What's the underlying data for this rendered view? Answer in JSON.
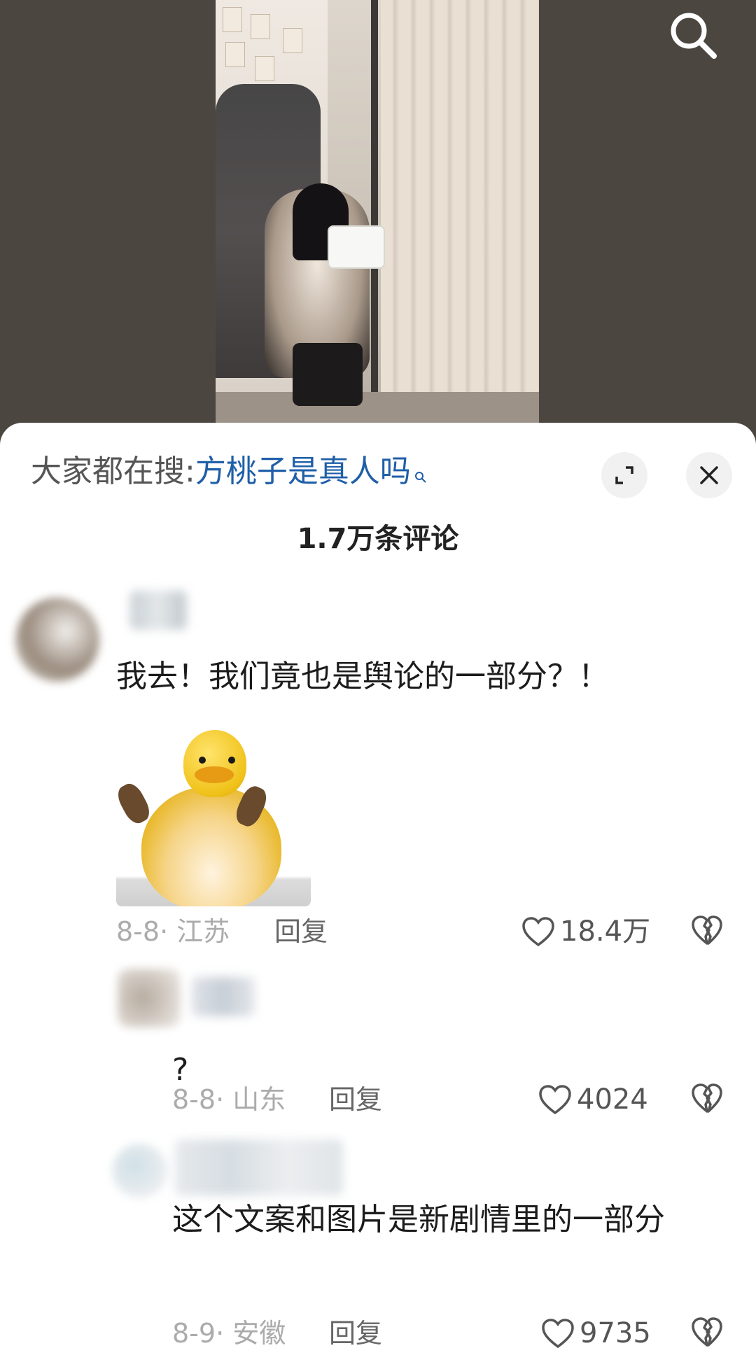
{
  "search_hint": {
    "prefix": "大家都在搜:",
    "keyword": "方桃子是真人吗"
  },
  "comments_header": {
    "count_label": "1.7万条评论"
  },
  "comments": [
    {
      "text": "我去！我们竟也是舆论的一部分？！",
      "has_sticker": true,
      "date_location": "8-8· 江苏",
      "reply_label": "回复",
      "like_count": "18.4万"
    },
    {
      "text": "?",
      "has_sticker": false,
      "date_location": "8-8· 山东",
      "reply_label": "回复",
      "like_count": "4024"
    },
    {
      "text": "这个文案和图片是新剧情里的一部分",
      "has_sticker": false,
      "date_location": "8-9· 安徽",
      "reply_label": "回复",
      "like_count": "9735"
    }
  ],
  "icons": {
    "top_right": "search-icon",
    "expand": "expand-icon",
    "close": "close-icon",
    "like": "heart-icon",
    "dislike": "broken-heart-icon"
  },
  "colors": {
    "keyword_blue": "#1f5fa8",
    "meta_gray": "#ababab",
    "sheet_bg": "#ffffff"
  }
}
